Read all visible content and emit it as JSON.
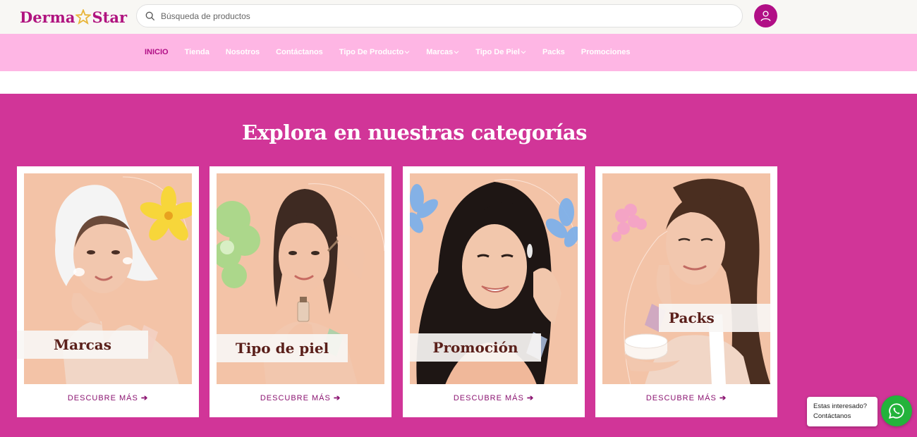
{
  "brand": {
    "name_part1": "Derma",
    "name_part2": "Star",
    "color": "#b0137f"
  },
  "search": {
    "placeholder": "Búsqueda de productos",
    "icon": "search-icon"
  },
  "user": {
    "icon": "user-icon"
  },
  "nav": {
    "items": [
      {
        "label": "INICIO",
        "active": true
      },
      {
        "label": "Tienda"
      },
      {
        "label": "Nosotros"
      },
      {
        "label": "Contáctanos"
      },
      {
        "label": "Tipo De Producto",
        "dropdown": true
      },
      {
        "label": "Marcas",
        "dropdown": true
      },
      {
        "label": "Tipo De Piel",
        "dropdown": true
      },
      {
        "label": "Packs"
      },
      {
        "label": "Promociones"
      }
    ]
  },
  "categories": {
    "title": "Explora en nuestras categorías",
    "cards": [
      {
        "label": "Marcas",
        "cta": "DESCUBRE MÁS"
      },
      {
        "label": "Tipo de piel",
        "cta": "DESCUBRE MÁS"
      },
      {
        "label": "Promoción",
        "cta": "DESCUBRE MÁS"
      },
      {
        "label": "Packs",
        "cta": "DESCUBRE MÁS"
      }
    ]
  },
  "chat": {
    "line1": "Estas interesado?",
    "line2": "Contáctanos",
    "icon": "whatsapp-icon"
  },
  "colors": {
    "accent": "#b10f86",
    "nav_bg": "#feb6e4",
    "hero_bg": "#d13598",
    "card_photo_bg": "#f3c3a7",
    "whatsapp": "#23b33b"
  }
}
